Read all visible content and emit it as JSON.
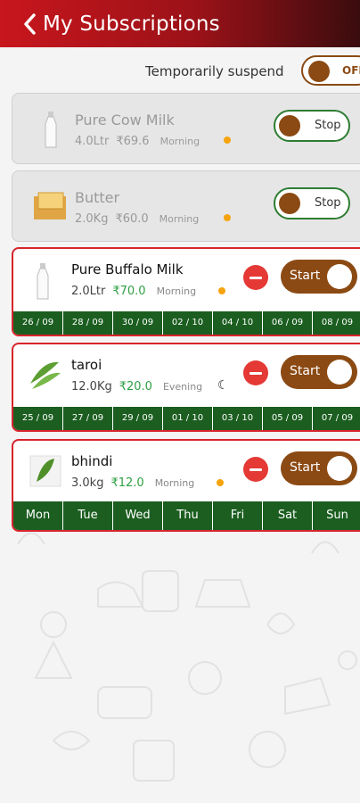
{
  "header": {
    "title": "My Subscriptions"
  },
  "suspend": {
    "label": "Temporarily suspend",
    "state": "OFF"
  },
  "subscriptions": [
    {
      "name": "Pure Cow Milk",
      "qty": "4.0Ltr",
      "price": "₹69.6",
      "slot": "Morning",
      "toggle": "Stop"
    },
    {
      "name": "Butter",
      "qty": "2.0Kg",
      "price": "₹60.0",
      "slot": "Morning",
      "toggle": "Stop"
    },
    {
      "name": "Pure Buffalo Milk",
      "qty": "2.0Ltr",
      "price": "₹70.0",
      "slot": "Morning",
      "toggle": "Start",
      "dates": [
        "26 / 09",
        "28 / 09",
        "30 / 09",
        "02 / 10",
        "04 / 10",
        "06 / 09",
        "08 / 09"
      ]
    },
    {
      "name": "taroi",
      "qty": "12.0Kg",
      "price": "₹20.0",
      "slot": "Evening",
      "toggle": "Start",
      "dates": [
        "25 / 09",
        "27 / 09",
        "29 / 09",
        "01 / 10",
        "03 / 10",
        "05 / 09",
        "07 / 09"
      ]
    },
    {
      "name": "bhindi",
      "qty": "3.0kg",
      "price": "₹12.0",
      "slot": "Morning",
      "toggle": "Start",
      "days": [
        "Mon",
        "Tue",
        "Wed",
        "Thu",
        "Fri",
        "Sat",
        "Sun"
      ]
    }
  ],
  "colors": {
    "header_start": "#c8161d",
    "header_end": "#3a0c0e",
    "date_bar": "#1b5e20",
    "toggle_brown": "#8b4a13",
    "price_green": "#2ea043"
  }
}
